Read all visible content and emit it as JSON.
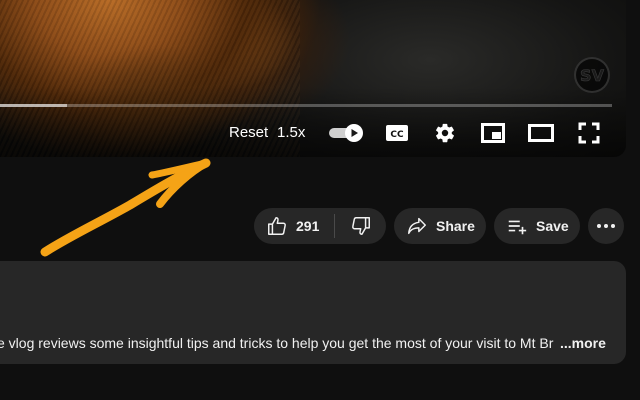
{
  "player": {
    "reset_label": "Reset",
    "speed_label": "1.5x",
    "progress_fraction": 0.11,
    "icons": [
      "autoplay-toggle-icon",
      "captions-icon",
      "settings-icon",
      "miniplayer-icon",
      "theater-mode-icon",
      "fullscreen-icon"
    ]
  },
  "actions": {
    "like_count": "291",
    "share_label": "Share",
    "save_label": "Save",
    "icons": [
      "thumbs-up-icon",
      "thumbs-down-icon",
      "share-arrow-icon",
      "playlist-add-icon",
      "more-dots-icon"
    ]
  },
  "description": {
    "text": "e vlog reviews some insightful tips and tricks to help you get the most of your visit to Mt Br",
    "more_label": "...more"
  },
  "colors": {
    "page_bg": "#0f0f0f",
    "pill_bg": "#272727",
    "annotation_arrow": "#f5a316"
  }
}
